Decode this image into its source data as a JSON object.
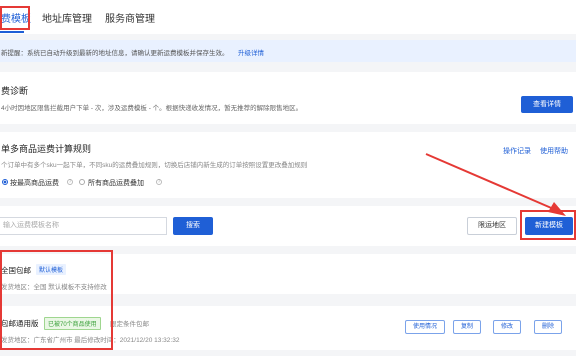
{
  "tabs": [
    {
      "label": "费模板"
    },
    {
      "label": "地址库管理"
    },
    {
      "label": "服务商管理"
    }
  ],
  "notice": {
    "text": "新提醒：系统已自动升级到最新的地址信息，请确认更新运费模板并保存生效。",
    "link": "升级详情"
  },
  "diagnosis": {
    "title": "费诊断",
    "desc": "4小时因地区限售拦截用户下单 - 次，涉及运费模板 - 个。根据快递收发情况，暂无推荐的解除限售地区。",
    "button": "查看详情"
  },
  "rule": {
    "title": "单多商品运费计算规则",
    "desc": "个订单中有多个sku一起下单，不同sku的运费叠加规则，切换后店铺内新生成的订单按照设置更改叠加规则",
    "link_log": "操作记录",
    "link_help": "使用帮助",
    "option1": "按最高商品运费",
    "option2": "所有商品运费叠加"
  },
  "search": {
    "placeholder": "输入运费模板名称",
    "button": "搜索",
    "restrict_button": "限运地区",
    "new_button": "新建模板"
  },
  "templates": [
    {
      "name": "全国包邮",
      "tag": "默认模板",
      "info": "发货地区：全国    默认模板不支持修改"
    },
    {
      "name": "包邮通用版",
      "tag": "已被70个商品使用",
      "tag2": "限定条件包邮",
      "info": "发货地区：广东省广州市    最后修改时间：2021/12/20 13:32:32",
      "actions": [
        "使用情况",
        "复制",
        "修改",
        "删除"
      ]
    }
  ],
  "colors": {
    "accent": "#1f5fd6",
    "annotation": "#e53935"
  }
}
